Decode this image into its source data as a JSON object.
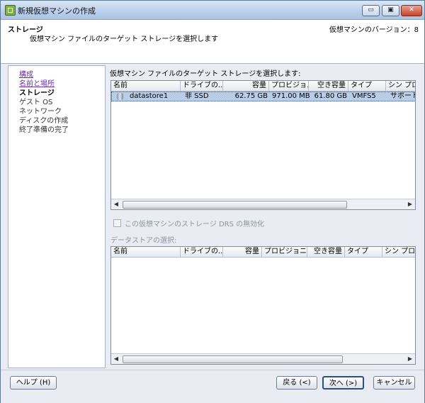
{
  "window": {
    "title": "新規仮想マシンの作成",
    "min": "▭",
    "max": "▣",
    "close": "✕"
  },
  "header": {
    "title": "ストレージ",
    "subtitle": "仮想マシン ファイルのターゲット ストレージを選択します",
    "version": "仮想マシンのバージョン：8"
  },
  "nav": {
    "items": [
      {
        "label": "構成",
        "state": "visited"
      },
      {
        "label": "名前と場所",
        "state": "visited"
      },
      {
        "label": "ストレージ",
        "state": "current"
      },
      {
        "label": "ゲスト OS",
        "state": "pending"
      },
      {
        "label": "ネットワーク",
        "state": "pending"
      },
      {
        "label": "ディスクの作成",
        "state": "pending"
      },
      {
        "label": "終了準備の完了",
        "state": "pending"
      }
    ]
  },
  "content": {
    "label": "仮想マシン ファイルのターゲット ストレージを選択します:",
    "table1": {
      "columns": [
        "名前",
        "ドライブの...",
        "容量",
        "プロビジョ...",
        "空き容量",
        "タイプ",
        "シン プロビ"
      ],
      "rows": [
        {
          "name": "datastore1",
          "drive": "非 SSD",
          "capacity": "62.75 GB",
          "provisioned": "971.00 MB",
          "free": "61.80 GB",
          "type": "VMFS5",
          "thin": "サポート済"
        }
      ]
    },
    "checkbox_label": "この仮想マシンのストレージ DRS の無効化",
    "datastore_label": "データストアの選択:",
    "table2": {
      "columns": [
        "名前",
        "ドライブの...",
        "容量",
        "プロビジョニン...",
        "空き容量",
        "タイプ",
        "シン プロビ"
      ]
    }
  },
  "scroll": {
    "left": "◀",
    "right": "▶"
  },
  "buttons": {
    "help": "ヘルプ (H)",
    "back": "戻る (<)",
    "next": "次へ (>)",
    "cancel": "キャンセル"
  }
}
